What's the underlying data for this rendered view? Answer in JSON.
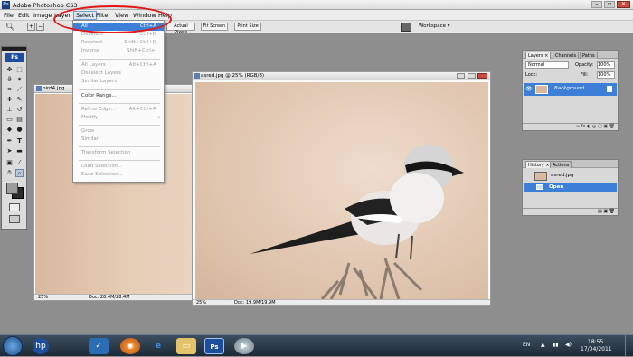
{
  "app": {
    "title": "Adobe Photoshop CS3",
    "icon_text": "Ps"
  },
  "menu": [
    "File",
    "Edit",
    "Image",
    "Layer",
    "Select",
    "Filter",
    "View",
    "Window",
    "Help"
  ],
  "options_bar": {
    "buttons": [
      "Actual Pixels",
      "Fit Screen",
      "Print Size"
    ],
    "workspace": "Workspace ▾"
  },
  "toolbox": {
    "badge": "Ps"
  },
  "select_menu": {
    "items": [
      {
        "label": "All",
        "shortcut": "Ctrl+A",
        "state": "highlighted"
      },
      {
        "label": "Deselect",
        "shortcut": "Ctrl+D",
        "state": "disabled"
      },
      {
        "label": "Reselect",
        "shortcut": "Shift+Ctrl+D",
        "state": "disabled"
      },
      {
        "label": "Inverse",
        "shortcut": "Shift+Ctrl+I",
        "state": "disabled"
      },
      {
        "label": "All Layers",
        "shortcut": "Alt+Ctrl+A",
        "state": "disabled"
      },
      {
        "label": "Deselect Layers",
        "shortcut": "",
        "state": "disabled"
      },
      {
        "label": "Similar Layers",
        "shortcut": "",
        "state": "disabled"
      },
      {
        "label": "Color Range...",
        "shortcut": "",
        "state": "enabled"
      },
      {
        "label": "Refine Edge...",
        "shortcut": "Alt+Ctrl+R",
        "state": "disabled"
      },
      {
        "label": "Modify",
        "shortcut": "▸",
        "state": "disabled"
      },
      {
        "label": "Grow",
        "shortcut": "",
        "state": "disabled"
      },
      {
        "label": "Similar",
        "shortcut": "",
        "state": "disabled"
      },
      {
        "label": "Transform Selection",
        "shortcut": "",
        "state": "disabled"
      },
      {
        "label": "Load Selection...",
        "shortcut": "",
        "state": "disabled"
      },
      {
        "label": "Save Selection...",
        "shortcut": "",
        "state": "disabled"
      }
    ]
  },
  "doc_back": {
    "title": "bird4.jpg",
    "zoom": "25%",
    "doc_info": "Doc: 28.4M/28.4M"
  },
  "doc_front": {
    "title": "asred.jpg @ 25% (RGB/8)",
    "zoom": "25%",
    "doc_info": "Doc: 19.9M/19.9M"
  },
  "layers_panel": {
    "tabs": [
      "Layers ×",
      "Channels",
      "Paths"
    ],
    "blend_mode": "Normal",
    "opacity_label": "Opacity:",
    "opacity_value": "100%",
    "lock_label": "Lock:",
    "fill_label": "Fill:",
    "fill_value": "100%",
    "layer_name": "Background"
  },
  "history_panel": {
    "tabs": [
      "History ×",
      "Actions"
    ],
    "snapshot": "asred.jpg",
    "state": "Open"
  },
  "taskbar": {
    "lang": "EN",
    "time": "18:55",
    "date": "17/04/2011"
  },
  "colors": {
    "highlight": "#3d7fd6",
    "annotation": "#e01818"
  }
}
